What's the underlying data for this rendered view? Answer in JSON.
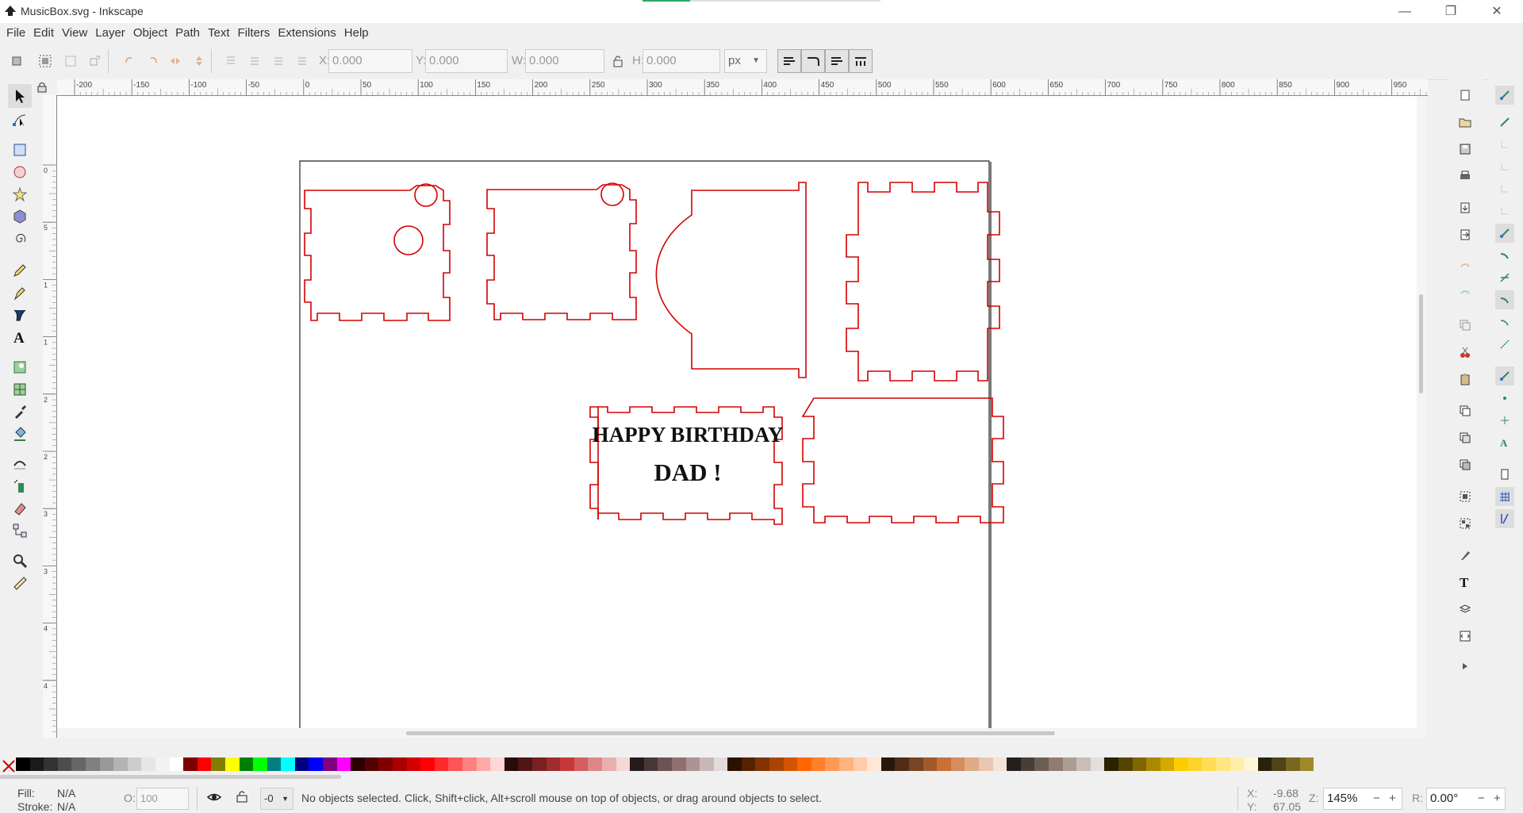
{
  "window": {
    "title": "MusicBox.svg - Inkscape"
  },
  "menu": [
    "File",
    "Edit",
    "View",
    "Layer",
    "Object",
    "Path",
    "Text",
    "Filters",
    "Extensions",
    "Help"
  ],
  "toolbar": {
    "x_label": "X:",
    "x_value": "0.000",
    "y_label": "Y:",
    "y_value": "0.000",
    "w_label": "W:",
    "w_value": "0.000",
    "h_label": "H:",
    "h_value": "0.000",
    "unit": "px"
  },
  "ruler": {
    "labels": [
      "-200",
      "-150",
      "-100",
      "-50",
      "0",
      "50",
      "100",
      "150",
      "200",
      "250",
      "300",
      "350",
      "400",
      "450",
      "500",
      "550",
      "600",
      "650",
      "700",
      "750",
      "800",
      "850",
      "900",
      "950"
    ]
  },
  "vruler": {
    "labels": [
      "0",
      "5",
      "1",
      "1",
      "2",
      "2",
      "3",
      "3",
      "4",
      "4"
    ]
  },
  "canvas": {
    "text_line1": "HAPPY BIRTHDAY",
    "text_line2": "DAD !"
  },
  "palette": {
    "colors": [
      "#000000",
      "#1a1a1a",
      "#333333",
      "#4d4d4d",
      "#666666",
      "#808080",
      "#999999",
      "#b3b3b3",
      "#cccccc",
      "#e6e6e6",
      "#f2f2f2",
      "#ffffff",
      "#800000",
      "#ff0000",
      "#808000",
      "#ffff00",
      "#008000",
      "#00ff00",
      "#008080",
      "#00ffff",
      "#000080",
      "#0000ff",
      "#800080",
      "#ff00ff",
      "#2b0000",
      "#550000",
      "#800000",
      "#aa0000",
      "#d40000",
      "#ff0000",
      "#ff2a2a",
      "#ff5555",
      "#ff8080",
      "#ffaaaa",
      "#ffd5d5",
      "#280b0b",
      "#501616",
      "#782121",
      "#a02c2c",
      "#c83737",
      "#d35f5f",
      "#de8787",
      "#e9afaf",
      "#f4d7d7",
      "#241c1c",
      "#483737",
      "#6c5353",
      "#916f6f",
      "#ac9393",
      "#c8b7b7",
      "#e3dbdb",
      "#2b1100",
      "#552200",
      "#803300",
      "#aa4400",
      "#d45500",
      "#ff6600",
      "#ff7f2a",
      "#ff9955",
      "#ffb380",
      "#ffccaa",
      "#ffe6d5",
      "#28170b",
      "#502d16",
      "#784421",
      "#a05a2c",
      "#c87137",
      "#d38d5f",
      "#deaa87",
      "#e9c6af",
      "#f4e3d7",
      "#241f1c",
      "#483e37",
      "#6c5d53",
      "#917c6f",
      "#ac9d93",
      "#c8beb7",
      "#e3dedb",
      "#2b2200",
      "#554400",
      "#806600",
      "#aa8800",
      "#d4aa00",
      "#ffcc00",
      "#ffd42a",
      "#ffdd55",
      "#ffe680",
      "#ffeeaa",
      "#fff6d5",
      "#28220b",
      "#504416",
      "#786721",
      "#a0892c"
    ]
  },
  "status": {
    "fill_label": "Fill:",
    "fill_value": "N/A",
    "stroke_label": "Stroke:",
    "stroke_value": "N/A",
    "opacity_label": "O:",
    "opacity_value": "100",
    "layer_value": "-0",
    "message": "No objects selected. Click, Shift+click, Alt+scroll mouse on top of objects, or drag around objects to select.",
    "x_label": "X:",
    "x_value": "-9.68",
    "y_label": "Y:",
    "y_value": "67.05",
    "zoom_label": "Z:",
    "zoom_value": "145%",
    "rot_label": "R:",
    "rot_value": "0.00°"
  }
}
